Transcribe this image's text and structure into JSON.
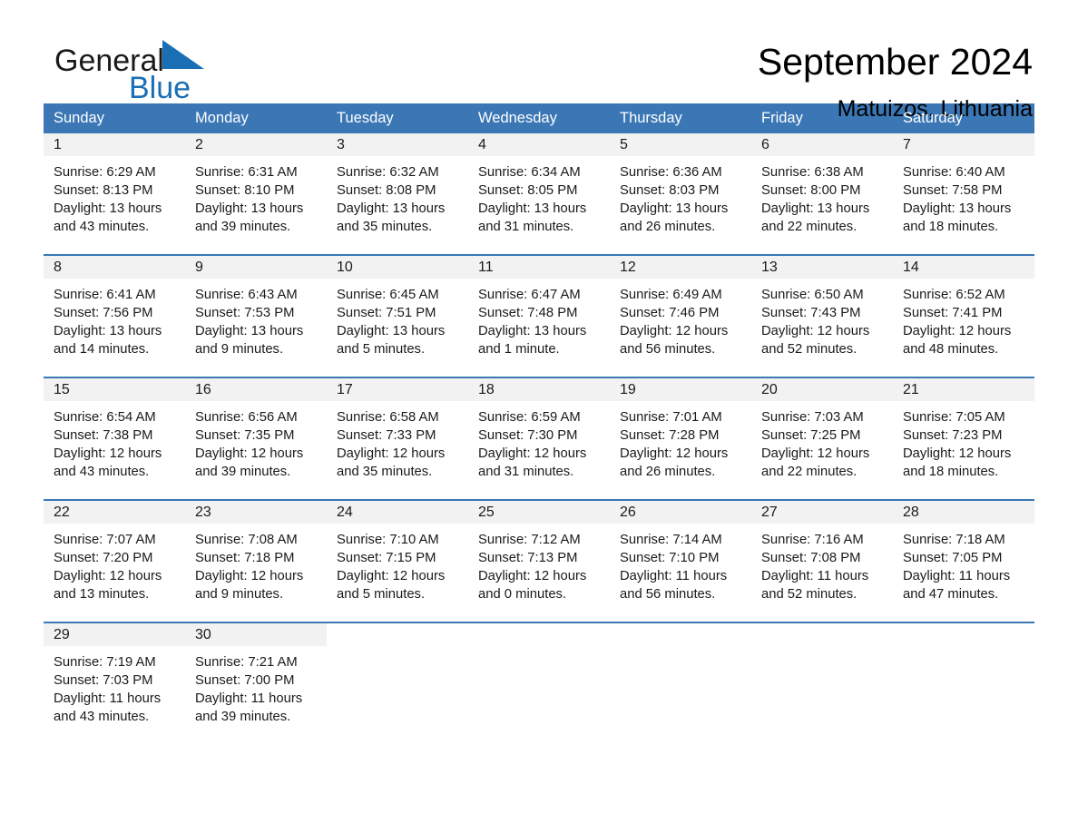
{
  "logo": {
    "word1": "General",
    "word2": "Blue",
    "triangle_color": "#1a6fb4",
    "blue_color": "#1a6fb4"
  },
  "header": {
    "month_title": "September 2024",
    "location": "Matuizos, Lithuania"
  },
  "colors": {
    "header_blue": "#3b77b5",
    "day_band_gray": "#f2f2f2",
    "text": "#1a1a1a"
  },
  "calendar": {
    "weekdays": [
      "Sunday",
      "Monday",
      "Tuesday",
      "Wednesday",
      "Thursday",
      "Friday",
      "Saturday"
    ],
    "weeks": [
      [
        {
          "day": "1",
          "lines": [
            "Sunrise: 6:29 AM",
            "Sunset: 8:13 PM",
            "Daylight: 13 hours",
            "and 43 minutes."
          ]
        },
        {
          "day": "2",
          "lines": [
            "Sunrise: 6:31 AM",
            "Sunset: 8:10 PM",
            "Daylight: 13 hours",
            "and 39 minutes."
          ]
        },
        {
          "day": "3",
          "lines": [
            "Sunrise: 6:32 AM",
            "Sunset: 8:08 PM",
            "Daylight: 13 hours",
            "and 35 minutes."
          ]
        },
        {
          "day": "4",
          "lines": [
            "Sunrise: 6:34 AM",
            "Sunset: 8:05 PM",
            "Daylight: 13 hours",
            "and 31 minutes."
          ]
        },
        {
          "day": "5",
          "lines": [
            "Sunrise: 6:36 AM",
            "Sunset: 8:03 PM",
            "Daylight: 13 hours",
            "and 26 minutes."
          ]
        },
        {
          "day": "6",
          "lines": [
            "Sunrise: 6:38 AM",
            "Sunset: 8:00 PM",
            "Daylight: 13 hours",
            "and 22 minutes."
          ]
        },
        {
          "day": "7",
          "lines": [
            "Sunrise: 6:40 AM",
            "Sunset: 7:58 PM",
            "Daylight: 13 hours",
            "and 18 minutes."
          ]
        }
      ],
      [
        {
          "day": "8",
          "lines": [
            "Sunrise: 6:41 AM",
            "Sunset: 7:56 PM",
            "Daylight: 13 hours",
            "and 14 minutes."
          ]
        },
        {
          "day": "9",
          "lines": [
            "Sunrise: 6:43 AM",
            "Sunset: 7:53 PM",
            "Daylight: 13 hours",
            "and 9 minutes."
          ]
        },
        {
          "day": "10",
          "lines": [
            "Sunrise: 6:45 AM",
            "Sunset: 7:51 PM",
            "Daylight: 13 hours",
            "and 5 minutes."
          ]
        },
        {
          "day": "11",
          "lines": [
            "Sunrise: 6:47 AM",
            "Sunset: 7:48 PM",
            "Daylight: 13 hours",
            "and 1 minute."
          ]
        },
        {
          "day": "12",
          "lines": [
            "Sunrise: 6:49 AM",
            "Sunset: 7:46 PM",
            "Daylight: 12 hours",
            "and 56 minutes."
          ]
        },
        {
          "day": "13",
          "lines": [
            "Sunrise: 6:50 AM",
            "Sunset: 7:43 PM",
            "Daylight: 12 hours",
            "and 52 minutes."
          ]
        },
        {
          "day": "14",
          "lines": [
            "Sunrise: 6:52 AM",
            "Sunset: 7:41 PM",
            "Daylight: 12 hours",
            "and 48 minutes."
          ]
        }
      ],
      [
        {
          "day": "15",
          "lines": [
            "Sunrise: 6:54 AM",
            "Sunset: 7:38 PM",
            "Daylight: 12 hours",
            "and 43 minutes."
          ]
        },
        {
          "day": "16",
          "lines": [
            "Sunrise: 6:56 AM",
            "Sunset: 7:35 PM",
            "Daylight: 12 hours",
            "and 39 minutes."
          ]
        },
        {
          "day": "17",
          "lines": [
            "Sunrise: 6:58 AM",
            "Sunset: 7:33 PM",
            "Daylight: 12 hours",
            "and 35 minutes."
          ]
        },
        {
          "day": "18",
          "lines": [
            "Sunrise: 6:59 AM",
            "Sunset: 7:30 PM",
            "Daylight: 12 hours",
            "and 31 minutes."
          ]
        },
        {
          "day": "19",
          "lines": [
            "Sunrise: 7:01 AM",
            "Sunset: 7:28 PM",
            "Daylight: 12 hours",
            "and 26 minutes."
          ]
        },
        {
          "day": "20",
          "lines": [
            "Sunrise: 7:03 AM",
            "Sunset: 7:25 PM",
            "Daylight: 12 hours",
            "and 22 minutes."
          ]
        },
        {
          "day": "21",
          "lines": [
            "Sunrise: 7:05 AM",
            "Sunset: 7:23 PM",
            "Daylight: 12 hours",
            "and 18 minutes."
          ]
        }
      ],
      [
        {
          "day": "22",
          "lines": [
            "Sunrise: 7:07 AM",
            "Sunset: 7:20 PM",
            "Daylight: 12 hours",
            "and 13 minutes."
          ]
        },
        {
          "day": "23",
          "lines": [
            "Sunrise: 7:08 AM",
            "Sunset: 7:18 PM",
            "Daylight: 12 hours",
            "and 9 minutes."
          ]
        },
        {
          "day": "24",
          "lines": [
            "Sunrise: 7:10 AM",
            "Sunset: 7:15 PM",
            "Daylight: 12 hours",
            "and 5 minutes."
          ]
        },
        {
          "day": "25",
          "lines": [
            "Sunrise: 7:12 AM",
            "Sunset: 7:13 PM",
            "Daylight: 12 hours",
            "and 0 minutes."
          ]
        },
        {
          "day": "26",
          "lines": [
            "Sunrise: 7:14 AM",
            "Sunset: 7:10 PM",
            "Daylight: 11 hours",
            "and 56 minutes."
          ]
        },
        {
          "day": "27",
          "lines": [
            "Sunrise: 7:16 AM",
            "Sunset: 7:08 PM",
            "Daylight: 11 hours",
            "and 52 minutes."
          ]
        },
        {
          "day": "28",
          "lines": [
            "Sunrise: 7:18 AM",
            "Sunset: 7:05 PM",
            "Daylight: 11 hours",
            "and 47 minutes."
          ]
        }
      ],
      [
        {
          "day": "29",
          "lines": [
            "Sunrise: 7:19 AM",
            "Sunset: 7:03 PM",
            "Daylight: 11 hours",
            "and 43 minutes."
          ]
        },
        {
          "day": "30",
          "lines": [
            "Sunrise: 7:21 AM",
            "Sunset: 7:00 PM",
            "Daylight: 11 hours",
            "and 39 minutes."
          ]
        },
        {
          "day": "",
          "lines": []
        },
        {
          "day": "",
          "lines": []
        },
        {
          "day": "",
          "lines": []
        },
        {
          "day": "",
          "lines": []
        },
        {
          "day": "",
          "lines": []
        }
      ]
    ]
  }
}
